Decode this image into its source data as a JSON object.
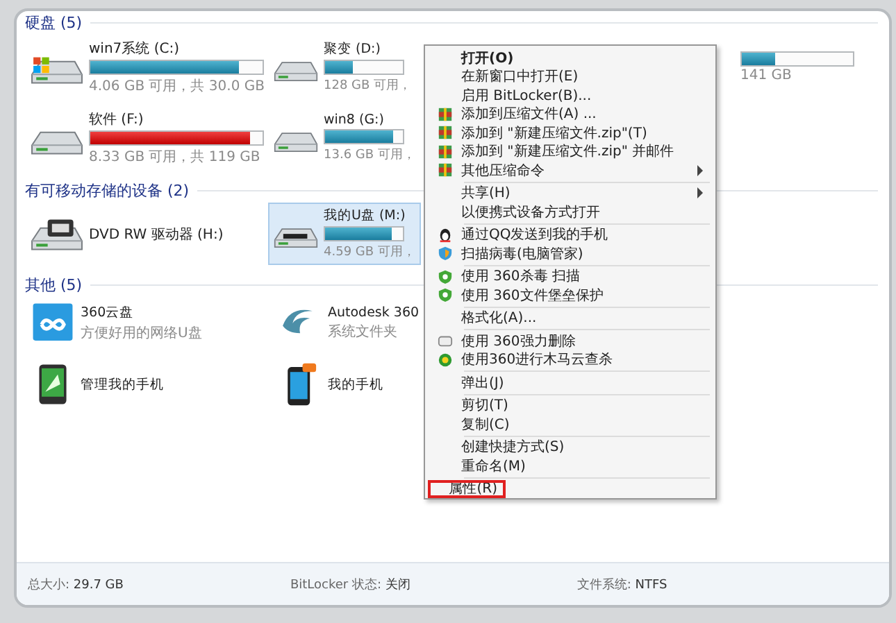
{
  "sections": [
    {
      "title": "硬盘 (5)",
      "kind": "drives",
      "items": [
        {
          "name": "win7系统 (C:)",
          "kind": "system",
          "capacity": "4.06 GB 可用，共 30.0 GB",
          "level": 0.86,
          "selected": false
        },
        {
          "name": "聚变 (D:)",
          "kind": "disk",
          "capacity": "128 GB 可用，",
          "level": 0.35,
          "selected": false
        },
        {
          "kind": "hidden",
          "capacity": "141 GB",
          "level": 0.3,
          "selected": false
        },
        {
          "name": "软件 (F:)",
          "kind": "disk",
          "capacity": "8.33 GB 可用，共 119 GB",
          "level": 0.93,
          "selected": false
        },
        {
          "name": "win8 (G:)",
          "kind": "disk",
          "capacity": "13.6 GB 可用，",
          "level": 0.88,
          "selected": false
        }
      ]
    },
    {
      "title": "有可移动存储的设备 (2)",
      "kind": "drives",
      "items": [
        {
          "name": "DVD RW 驱动器 (H:)",
          "kind": "dvd",
          "selected": false
        },
        {
          "name": "我的U盘 (M:)",
          "kind": "usb",
          "capacity": "4.59 GB 可用，",
          "level": 0.85,
          "selected": true
        }
      ]
    },
    {
      "title": "其他 (5)",
      "kind": "others",
      "items": [
        {
          "name": "360云盘",
          "subtitle": "方便好用的网络U盘",
          "kind": "cloud"
        },
        {
          "name": "Autodesk 360",
          "subtitle": "系统文件夹",
          "kind": "swirl"
        },
        {
          "name": "管理我的手机",
          "kind": "tablet"
        },
        {
          "name": "我的手机",
          "kind": "phone"
        }
      ]
    }
  ],
  "details": [
    {
      "label": "总大小:",
      "value": "29.7 GB"
    },
    {
      "label": "BitLocker 状态:",
      "value": "关闭"
    },
    {
      "label": "文件系统:",
      "value": "NTFS"
    }
  ],
  "context_menu": [
    {
      "label": "打开(O)",
      "kind": "plain",
      "bold": true,
      "submenu": false,
      "marked": false
    },
    {
      "label": "在新窗口中打开(E)",
      "kind": "plain",
      "bold": false,
      "submenu": false,
      "marked": false
    },
    {
      "label": "启用 BitLocker(B)...",
      "kind": "plain",
      "bold": false,
      "submenu": false,
      "marked": false
    },
    {
      "label": "添加到压缩文件(A) ...",
      "kind": "archive",
      "bold": false,
      "submenu": false,
      "marked": false
    },
    {
      "label": "添加到 \"新建压缩文件.zip\"(T)",
      "kind": "archive",
      "bold": false,
      "submenu": false,
      "marked": false
    },
    {
      "label": "添加到 \"新建压缩文件.zip\" 并邮件",
      "kind": "archive",
      "bold": false,
      "submenu": false,
      "marked": false
    },
    {
      "label": "其他压缩命令",
      "kind": "archive",
      "bold": false,
      "submenu": true,
      "marked": false
    },
    {
      "kind": "separator"
    },
    {
      "label": "共享(H)",
      "kind": "plain",
      "bold": false,
      "submenu": true,
      "marked": false
    },
    {
      "label": "以便携式设备方式打开",
      "kind": "plain",
      "bold": false,
      "submenu": false,
      "marked": false
    },
    {
      "kind": "separator"
    },
    {
      "label": "通过QQ发送到我的手机",
      "kind": "qq",
      "bold": false,
      "submenu": false,
      "marked": false
    },
    {
      "label": "扫描病毒(电脑管家)",
      "kind": "scan",
      "bold": false,
      "submenu": false,
      "marked": false
    },
    {
      "kind": "separator"
    },
    {
      "label": "使用 360杀毒 扫描",
      "kind": "antivirus",
      "bold": false,
      "submenu": false,
      "marked": false
    },
    {
      "label": "使用 360文件堡垒保护",
      "kind": "antivirus",
      "bold": false,
      "submenu": false,
      "marked": false
    },
    {
      "kind": "separator"
    },
    {
      "label": "格式化(A)...",
      "kind": "plain",
      "bold": false,
      "submenu": false,
      "marked": false
    },
    {
      "kind": "separator"
    },
    {
      "label": "使用 360强力删除",
      "kind": "delete",
      "bold": false,
      "submenu": false,
      "marked": false
    },
    {
      "label": "使用360进行木马云查杀",
      "kind": "trojan",
      "bold": false,
      "submenu": false,
      "marked": false
    },
    {
      "kind": "separator"
    },
    {
      "label": "弹出(J)",
      "kind": "plain",
      "bold": false,
      "submenu": false,
      "marked": false
    },
    {
      "kind": "separator"
    },
    {
      "label": "剪切(T)",
      "kind": "plain",
      "bold": false,
      "submenu": false,
      "marked": false
    },
    {
      "label": "复制(C)",
      "kind": "plain",
      "bold": false,
      "submenu": false,
      "marked": false
    },
    {
      "kind": "separator"
    },
    {
      "label": "创建快捷方式(S)",
      "kind": "plain",
      "bold": false,
      "submenu": false,
      "marked": false
    },
    {
      "label": "重命名(M)",
      "kind": "plain",
      "bold": false,
      "submenu": false,
      "marked": false
    },
    {
      "kind": "separator"
    },
    {
      "label": "属性(R)",
      "kind": "plain",
      "bold": false,
      "submenu": false,
      "marked": true
    }
  ]
}
